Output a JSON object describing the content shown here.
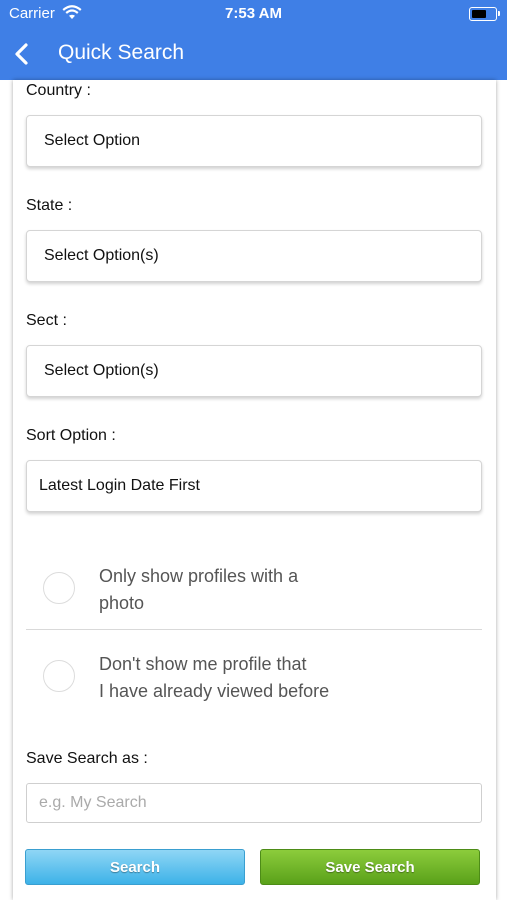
{
  "status_bar": {
    "carrier": "Carrier",
    "time": "7:53 AM"
  },
  "nav": {
    "title": "Quick Search",
    "back_icon": "chevron-left-icon"
  },
  "form": {
    "country": {
      "label": "Country :",
      "value": "Select Option"
    },
    "state": {
      "label": "State :",
      "value": "Select Option(s)"
    },
    "sect": {
      "label": "Sect :",
      "value": "Select Option(s)"
    },
    "sort": {
      "label": "Sort Option :",
      "value": "Latest Login Date First"
    },
    "photo_option": {
      "line1": "Only show profiles with a",
      "line2": "photo"
    },
    "viewed_option": {
      "line1": "Don't show me profile that",
      "line2": "I have already viewed before"
    },
    "save_search": {
      "label": "Save Search as :",
      "placeholder": "e.g. My Search",
      "value": ""
    }
  },
  "buttons": {
    "search": "Search",
    "save_search": "Save Search"
  },
  "colors": {
    "header": "#3f7fe6",
    "search_button": "#3db2e8",
    "save_button": "#5aa11a"
  }
}
